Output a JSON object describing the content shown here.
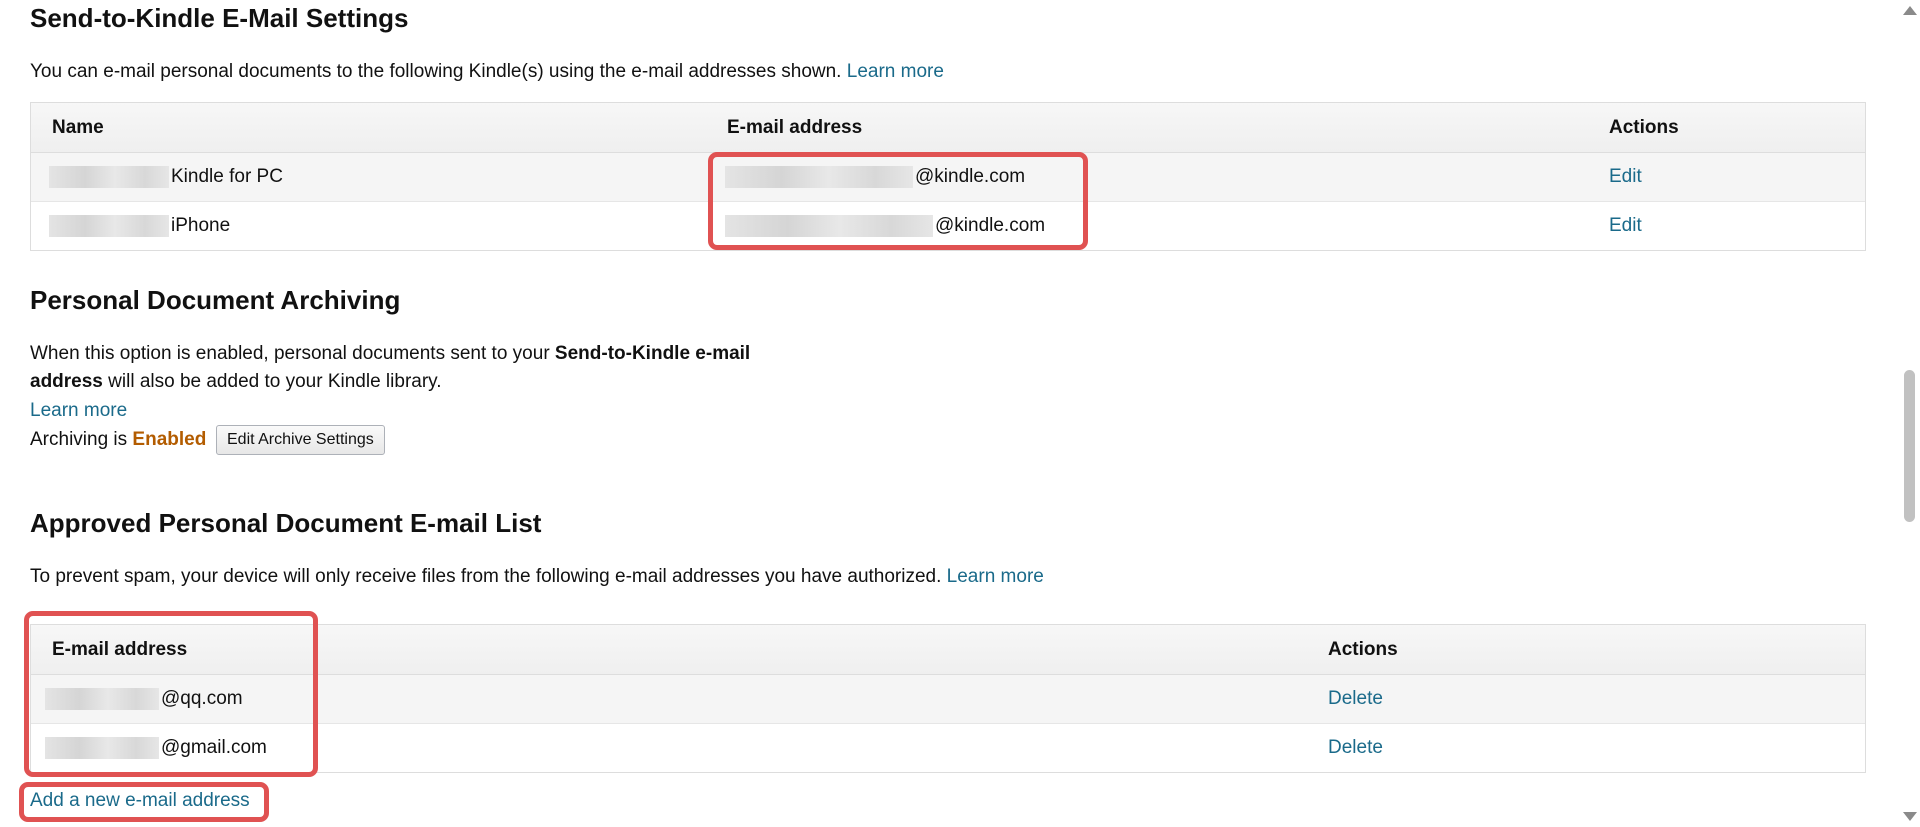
{
  "send_to_kindle": {
    "title": "Send-to-Kindle E-Mail Settings",
    "description": "You can e-mail personal documents to the following Kindle(s) using the e-mail addresses shown.",
    "learn_more": "Learn more",
    "table": {
      "headers": {
        "name": "Name",
        "email": "E-mail address",
        "actions": "Actions"
      },
      "rows": [
        {
          "name": "Kindle for PC",
          "email_suffix": "@kindle.com",
          "action": "Edit"
        },
        {
          "name": "iPhone",
          "email_suffix": "@kindle.com",
          "action": "Edit"
        }
      ]
    }
  },
  "archiving": {
    "title": "Personal Document Archiving",
    "desc_part1": "When this option is enabled, personal documents sent to your ",
    "desc_bold1": "Send-to-Kindle e-mail",
    "desc_bold2": "address",
    "desc_part2": " will also be added to your Kindle library.",
    "learn_more": "Learn more",
    "status_label": "Archiving is ",
    "status_value": "Enabled",
    "edit_button": "Edit Archive Settings"
  },
  "approved": {
    "title": "Approved Personal Document E-mail List",
    "description": "To prevent spam, your device will only receive files from the following e-mail addresses you have authorized.",
    "learn_more": "Learn more",
    "table": {
      "headers": {
        "email": "E-mail address",
        "actions": "Actions"
      },
      "rows": [
        {
          "email_suffix": "@qq.com",
          "action": "Delete"
        },
        {
          "email_suffix": "@gmail.com",
          "action": "Delete"
        }
      ]
    },
    "add_link": "Add a new e-mail address"
  },
  "colors": {
    "link": "#1a6a8a",
    "enabled": "#b35c00",
    "highlight": "#e05252"
  }
}
